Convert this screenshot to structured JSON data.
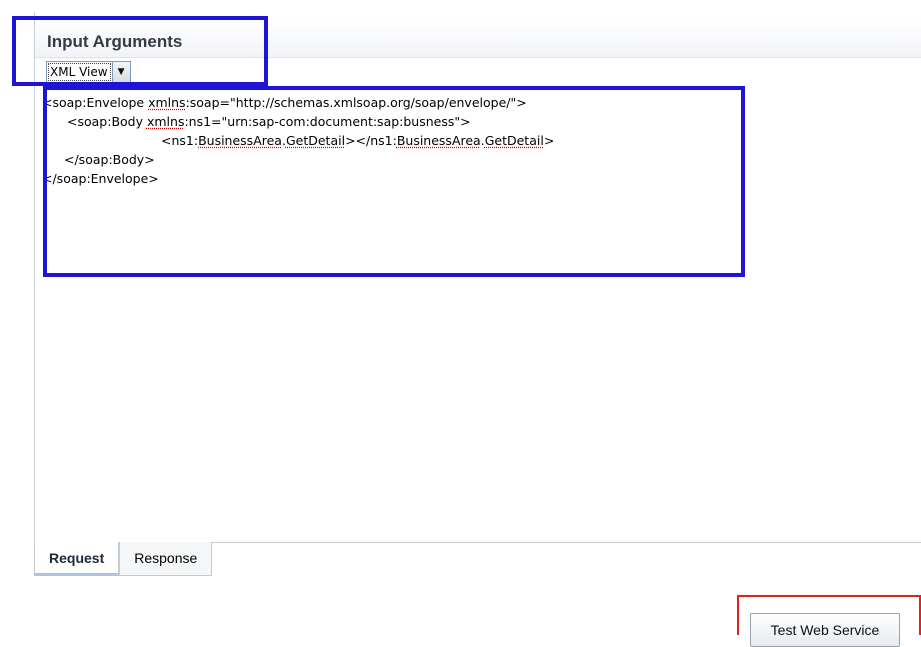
{
  "section": {
    "title": "Input Arguments"
  },
  "view_select": {
    "selected": "XML View",
    "arrow_glyph": "▼"
  },
  "xml": {
    "line1": [
      "<soap:Envelope ",
      "xmlns",
      ":soap=\"http://schemas.xmlsoap.org/soap/envelope/\">"
    ],
    "line2": [
      "<soap:Body ",
      "xmlns",
      ":ns1=\"urn:sap-com:document:sap:busness\">"
    ],
    "line3": [
      "<ns1:",
      "BusinessArea",
      ".",
      "GetDetail",
      "></ns1:",
      "BusinessArea",
      ".",
      "GetDetail",
      ">"
    ],
    "line4": "</soap:Body>",
    "line5": "</soap:Envelope>"
  },
  "tabs": {
    "request": "Request",
    "response": "Response",
    "active": "Request"
  },
  "actions": {
    "test_button": "Test Web Service"
  },
  "colors": {
    "highlight_blue": "#1d14d6",
    "highlight_red": "#e2231a",
    "active_tab_underline": "#a8c6e6"
  }
}
